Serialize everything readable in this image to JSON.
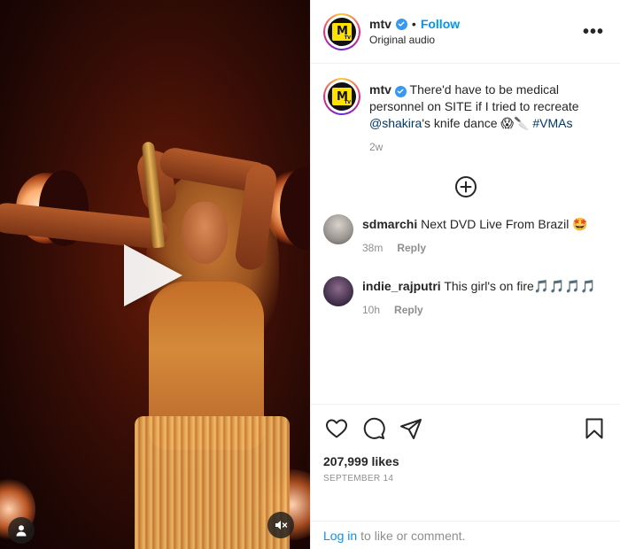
{
  "post": {
    "username": "mtv",
    "follow_label": "Follow",
    "dot": "•",
    "subtitle": "Original audio",
    "more": "•••"
  },
  "caption": {
    "username": "mtv",
    "text_before": " There'd have to be medical personnel on SITE if I tried to recreate ",
    "mention": "@shakira",
    "text_after": "'s knife dance 😱🔪 ",
    "hashtag": "#VMAs",
    "time": "2w"
  },
  "comments": [
    {
      "username": "sdmarchi",
      "text": "Next DVD Live From Brazil 🤩",
      "time": "38m",
      "reply": "Reply"
    },
    {
      "username": "indie_rajputri",
      "text": "This girl's on fire🎵🎵🎵🎵",
      "time": "10h",
      "reply": "Reply"
    }
  ],
  "stats": {
    "likes": "207,999 likes",
    "date": "September 14"
  },
  "login": {
    "link": "Log in",
    "rest": "to like or comment."
  },
  "icons": {
    "like": "heart-icon",
    "comment": "comment-bubble-icon",
    "share": "paper-plane-icon",
    "save": "bookmark-icon",
    "load_more": "plus-circle-icon",
    "play": "play-icon",
    "mute": "muted-speaker-icon",
    "user_tags": "user-icon"
  },
  "colors": {
    "accent": "#0095f6",
    "verified": "#3897f0",
    "mtv_yellow": "#ffe200"
  }
}
